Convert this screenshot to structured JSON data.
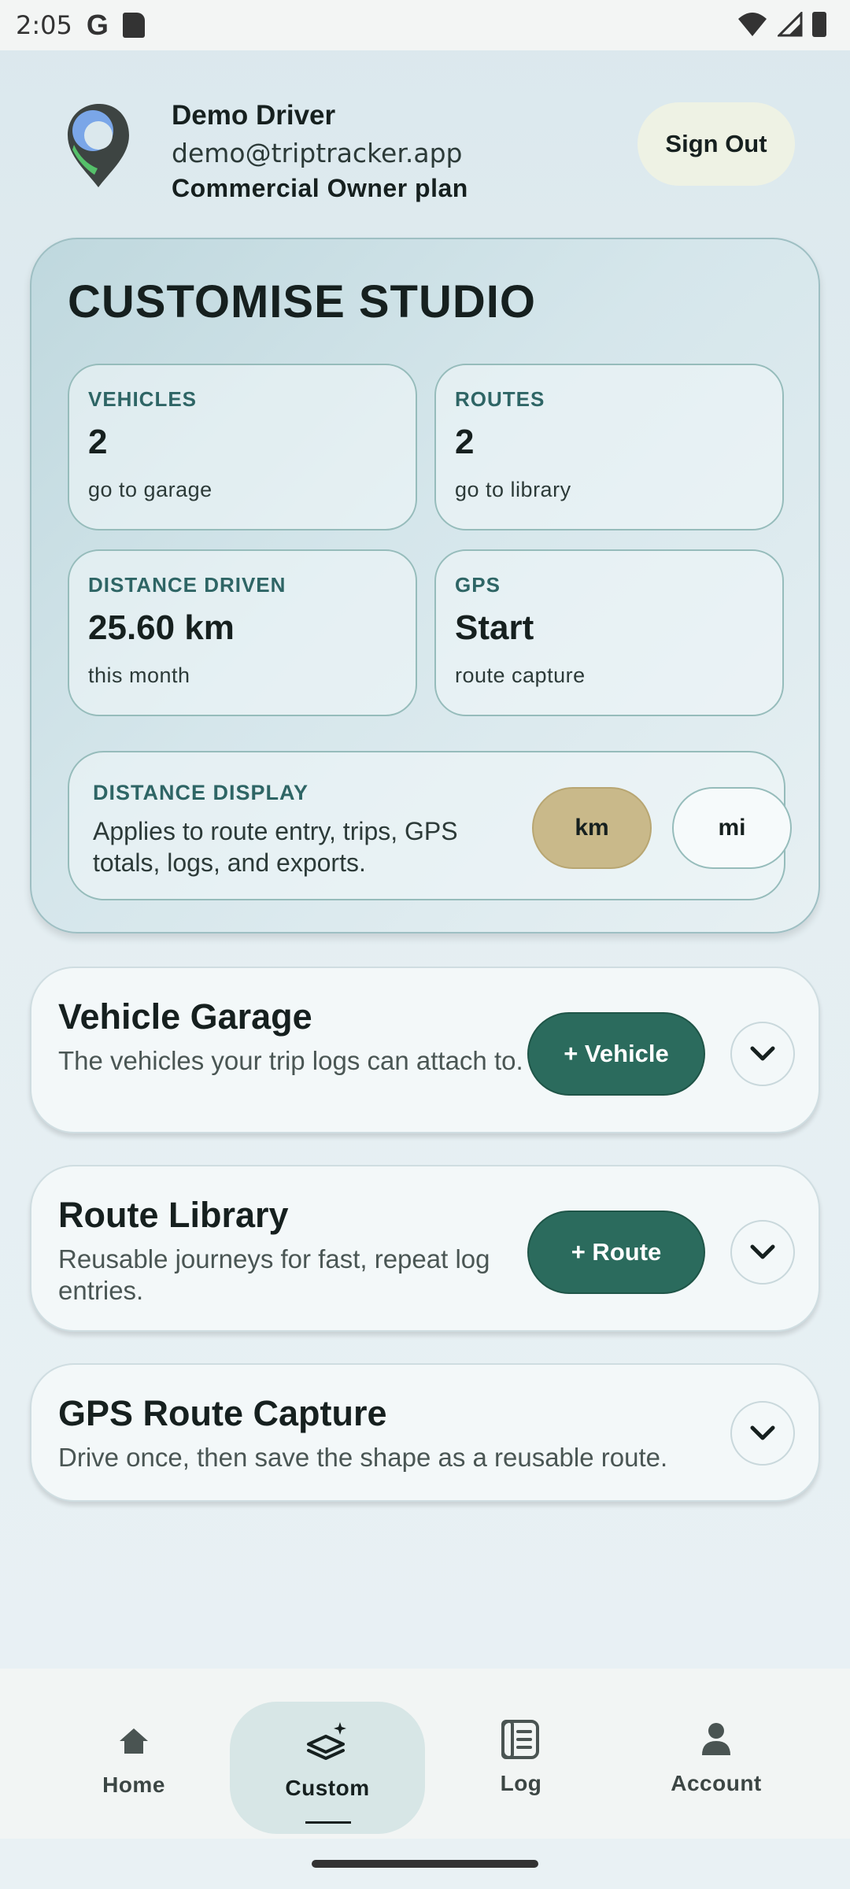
{
  "status_bar": {
    "time": "2:05",
    "g_label": "G"
  },
  "header": {
    "name": "Demo Driver",
    "email": "demo@triptracker.app",
    "plan": "Commercial Owner plan",
    "sign_out": "Sign Out"
  },
  "studio": {
    "title": "CUSTOMISE STUDIO",
    "stats": [
      {
        "label": "VEHICLES",
        "value": "2",
        "sub": "go to garage"
      },
      {
        "label": "ROUTES",
        "value": "2",
        "sub": "go to library"
      },
      {
        "label": "DISTANCE DRIVEN",
        "value": "25.60 km",
        "sub": "this month"
      },
      {
        "label": "GPS",
        "value": "Start",
        "sub": "route capture"
      }
    ],
    "distance_display": {
      "label": "DISTANCE DISPLAY",
      "desc": "Applies to route entry, trips, GPS totals, logs, and exports.",
      "km": "km",
      "mi": "mi",
      "selected": "km"
    }
  },
  "sections": [
    {
      "title": "Vehicle Garage",
      "desc": "The vehicles your trip logs can attach to.",
      "button": "+ Vehicle"
    },
    {
      "title": "Route Library",
      "desc": "Reusable journeys for fast, repeat log entries.",
      "button": "+ Route"
    },
    {
      "title": "GPS Route Capture",
      "desc": "Drive once, then save the shape as a reusable route."
    }
  ],
  "nav": {
    "items": [
      {
        "label": "Home",
        "icon": "home-icon"
      },
      {
        "label": "Custom",
        "icon": "layers-sparkle-icon"
      },
      {
        "label": "Log",
        "icon": "log-icon"
      },
      {
        "label": "Account",
        "icon": "person-icon"
      }
    ],
    "active": "Custom"
  },
  "colors": {
    "accent": "#2b6b5d",
    "selected_unit": "#c9b98a",
    "label_teal": "#2e6565"
  }
}
